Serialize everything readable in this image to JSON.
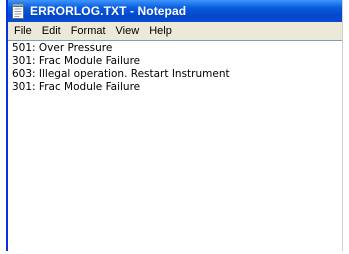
{
  "window": {
    "title": "ERRORLOG.TXT - Notepad",
    "icon": "notepad-icon"
  },
  "menu": {
    "items": [
      "File",
      "Edit",
      "Format",
      "View",
      "Help"
    ]
  },
  "document": {
    "lines": [
      "501: Over Pressure",
      "301: Frac Module Failure",
      "603: Illegal operation. Restart Instrument",
      "301: Frac Module Failure"
    ]
  },
  "colors": {
    "titlebar": "#0a5cde",
    "menubar": "#ece9d8",
    "editor_background": "#ffffff"
  }
}
